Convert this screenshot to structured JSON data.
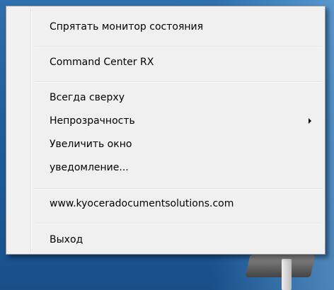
{
  "context_menu": {
    "items": [
      {
        "label": "Спрятать монитор состояния"
      },
      {
        "label": "Command Center RX"
      },
      {
        "label": "Всегда сверху"
      },
      {
        "label": "Непрозрачность",
        "has_submenu": true,
        "submenu_icon": "chevron-right-icon"
      },
      {
        "label": "Увеличить окно"
      },
      {
        "label": "уведомление..."
      },
      {
        "label": "www.kyoceradocumentsolutions.com"
      },
      {
        "label": "Выход"
      }
    ]
  },
  "colors": {
    "menu_background": "#f0f0f0",
    "desktop_background": "#1f5f9e"
  }
}
